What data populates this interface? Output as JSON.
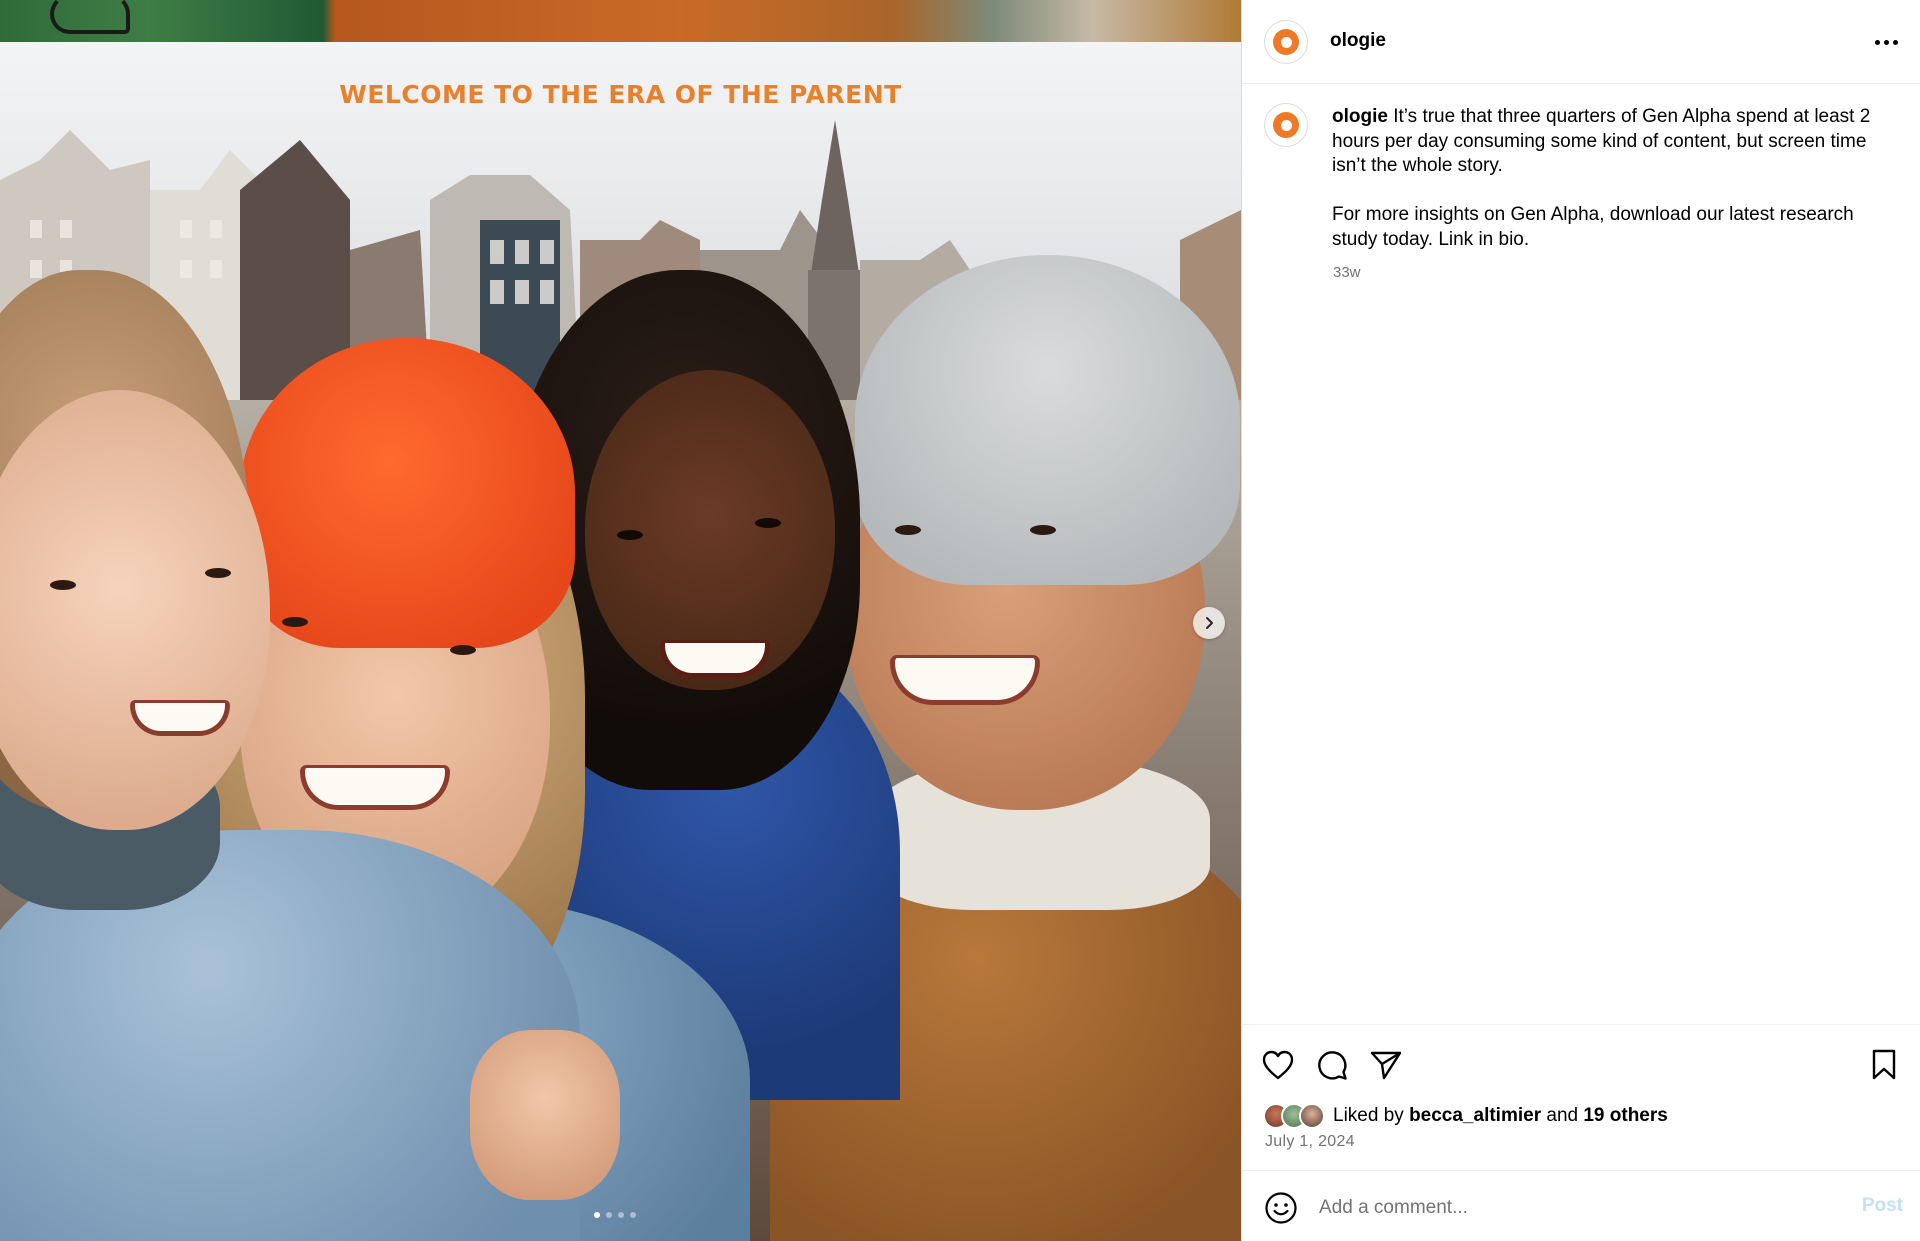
{
  "media": {
    "overlay_title": "WELCOME TO THE ERA OF THE PARENT",
    "carousel": {
      "slides": 4,
      "active_index": 0
    },
    "next_icon": "chevron-right-icon",
    "colors": {
      "accent_orange": "#e9812c",
      "red_hat": "#f2541f",
      "grey_hat": "#c9ccce"
    }
  },
  "post": {
    "username": "ologie",
    "more_icon": "more-horizontal-icon",
    "caption": {
      "username": "ologie",
      "paragraph_1": "It’s true that three quarters of Gen Alpha spend at least 2 hours per day consuming some kind of content, but screen time isn’t the whole story.",
      "paragraph_2": "For more insights on Gen Alpha, download our latest research study today. Link in bio."
    },
    "age": "33w",
    "likes": {
      "prefix": "Liked by",
      "user": "becca_altimier",
      "joiner": "and",
      "others": "19 others"
    },
    "date": "July 1, 2024"
  },
  "actions": {
    "like_icon": "heart-icon",
    "comment_icon": "comment-icon",
    "share_icon": "send-icon",
    "save_icon": "bookmark-icon"
  },
  "comment_box": {
    "placeholder": "Add a comment...",
    "post_label": "Post",
    "emoji_icon": "smiley-icon"
  },
  "brand_color": "#ef7a25"
}
